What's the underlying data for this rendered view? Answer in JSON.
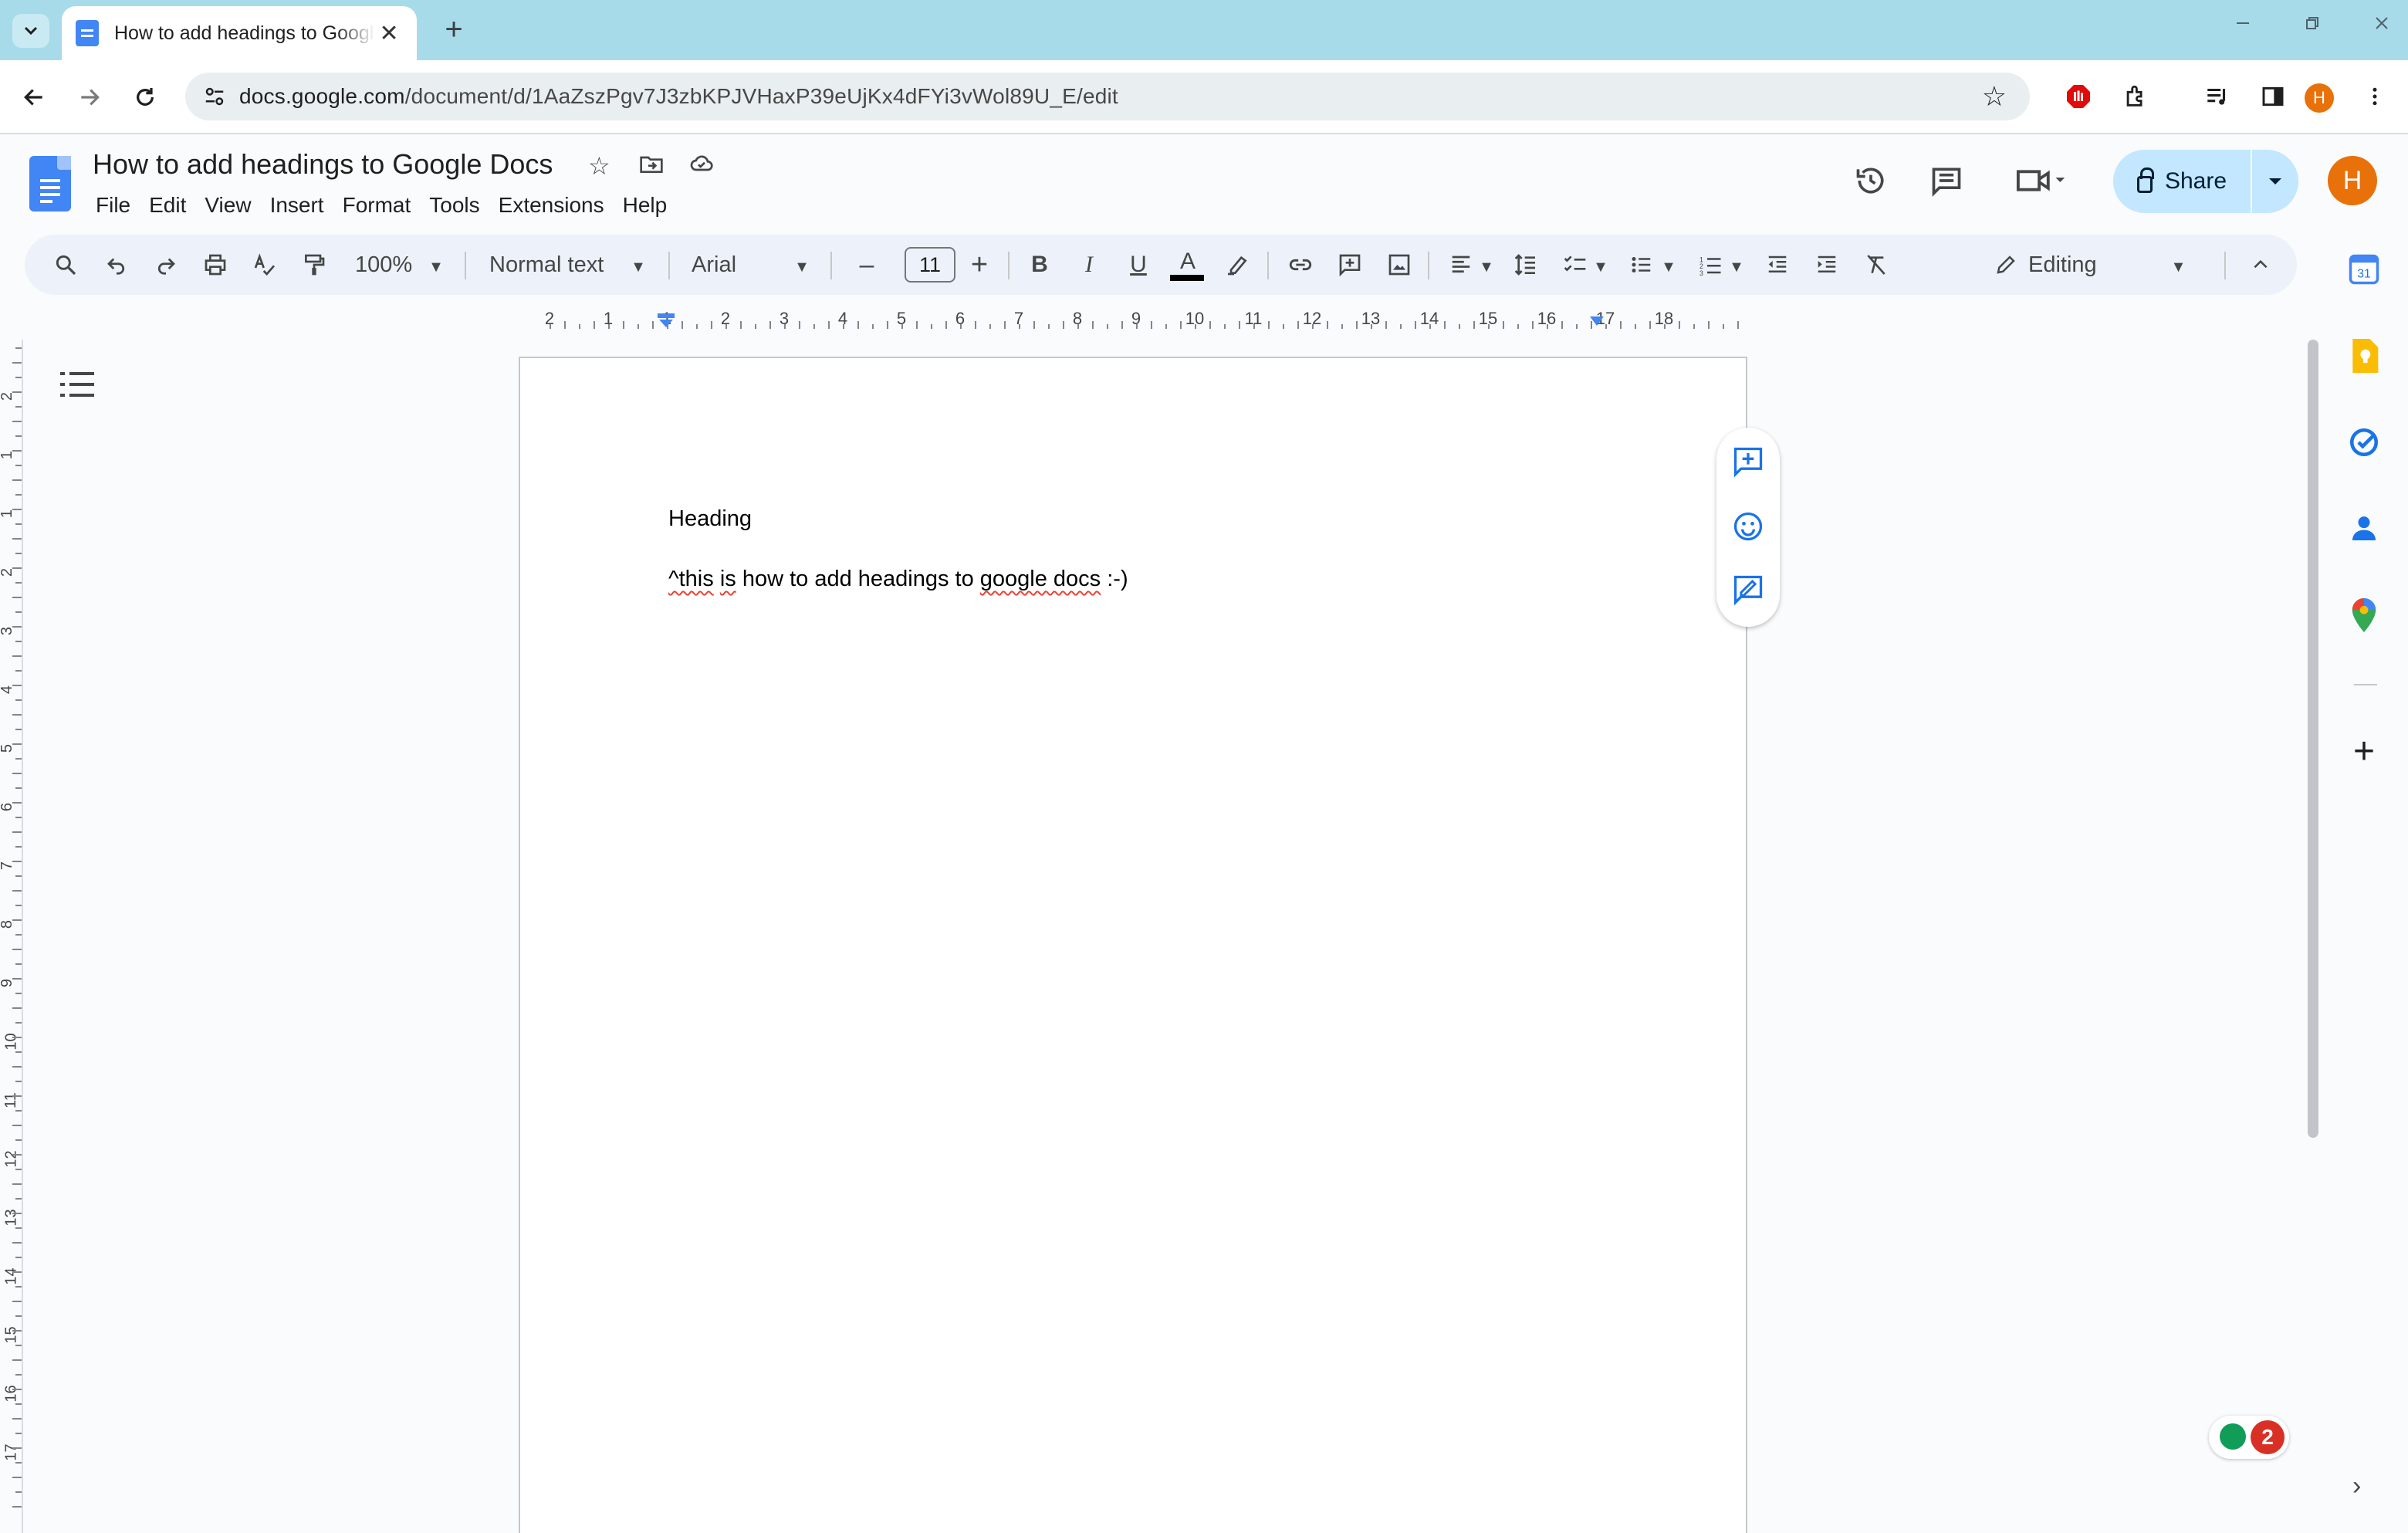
{
  "browser": {
    "tab_title": "How to add headings to Google Docs",
    "tab_close": "✕",
    "new_tab": "+",
    "url_domain": "docs.google.com",
    "url_path": "/document/d/1AaZszPgv7J3zbKPJVHaxP39eUjKx4dFYi3vWol89U_E/edit",
    "profile_initial": "H"
  },
  "docs": {
    "title": "How to add headings to Google Docs",
    "menu": [
      "File",
      "Edit",
      "View",
      "Insert",
      "Format",
      "Tools",
      "Extensions",
      "Help"
    ],
    "share_label": "Share",
    "avatar_initial": "H"
  },
  "toolbar": {
    "zoom": "100%",
    "style": "Normal text",
    "font": "Arial",
    "font_size": "11",
    "minus": "–",
    "plus": "+",
    "mode": "Editing",
    "text_color": "#000000"
  },
  "ruler": {
    "horizontal": [
      "2",
      "1",
      "1",
      "2",
      "3",
      "4",
      "5",
      "6",
      "7",
      "8",
      "9",
      "10",
      "11",
      "12",
      "13",
      "14",
      "15",
      "16",
      "17",
      "18"
    ],
    "vertical": [
      "2",
      "1",
      "1",
      "2",
      "3",
      "4",
      "5",
      "6",
      "7",
      "8",
      "9",
      "10",
      "11",
      "12",
      "13",
      "14",
      "15",
      "16",
      "17"
    ]
  },
  "document": {
    "heading": "Heading",
    "line2_part1": "^this",
    "line2_part2": " ",
    "line2_part3": "is",
    "line2_part4": " how to add headings to ",
    "line2_part5": "google docs",
    "line2_part6": " :-)"
  },
  "side_panel": {
    "calendar_day": "31",
    "add": "+"
  },
  "notifications": {
    "count": "2"
  },
  "colors": {
    "accent": "#1a73e8",
    "share_bg": "#c2e7ff",
    "avatar": "#e8710a",
    "spell_error": "#ea4335"
  }
}
